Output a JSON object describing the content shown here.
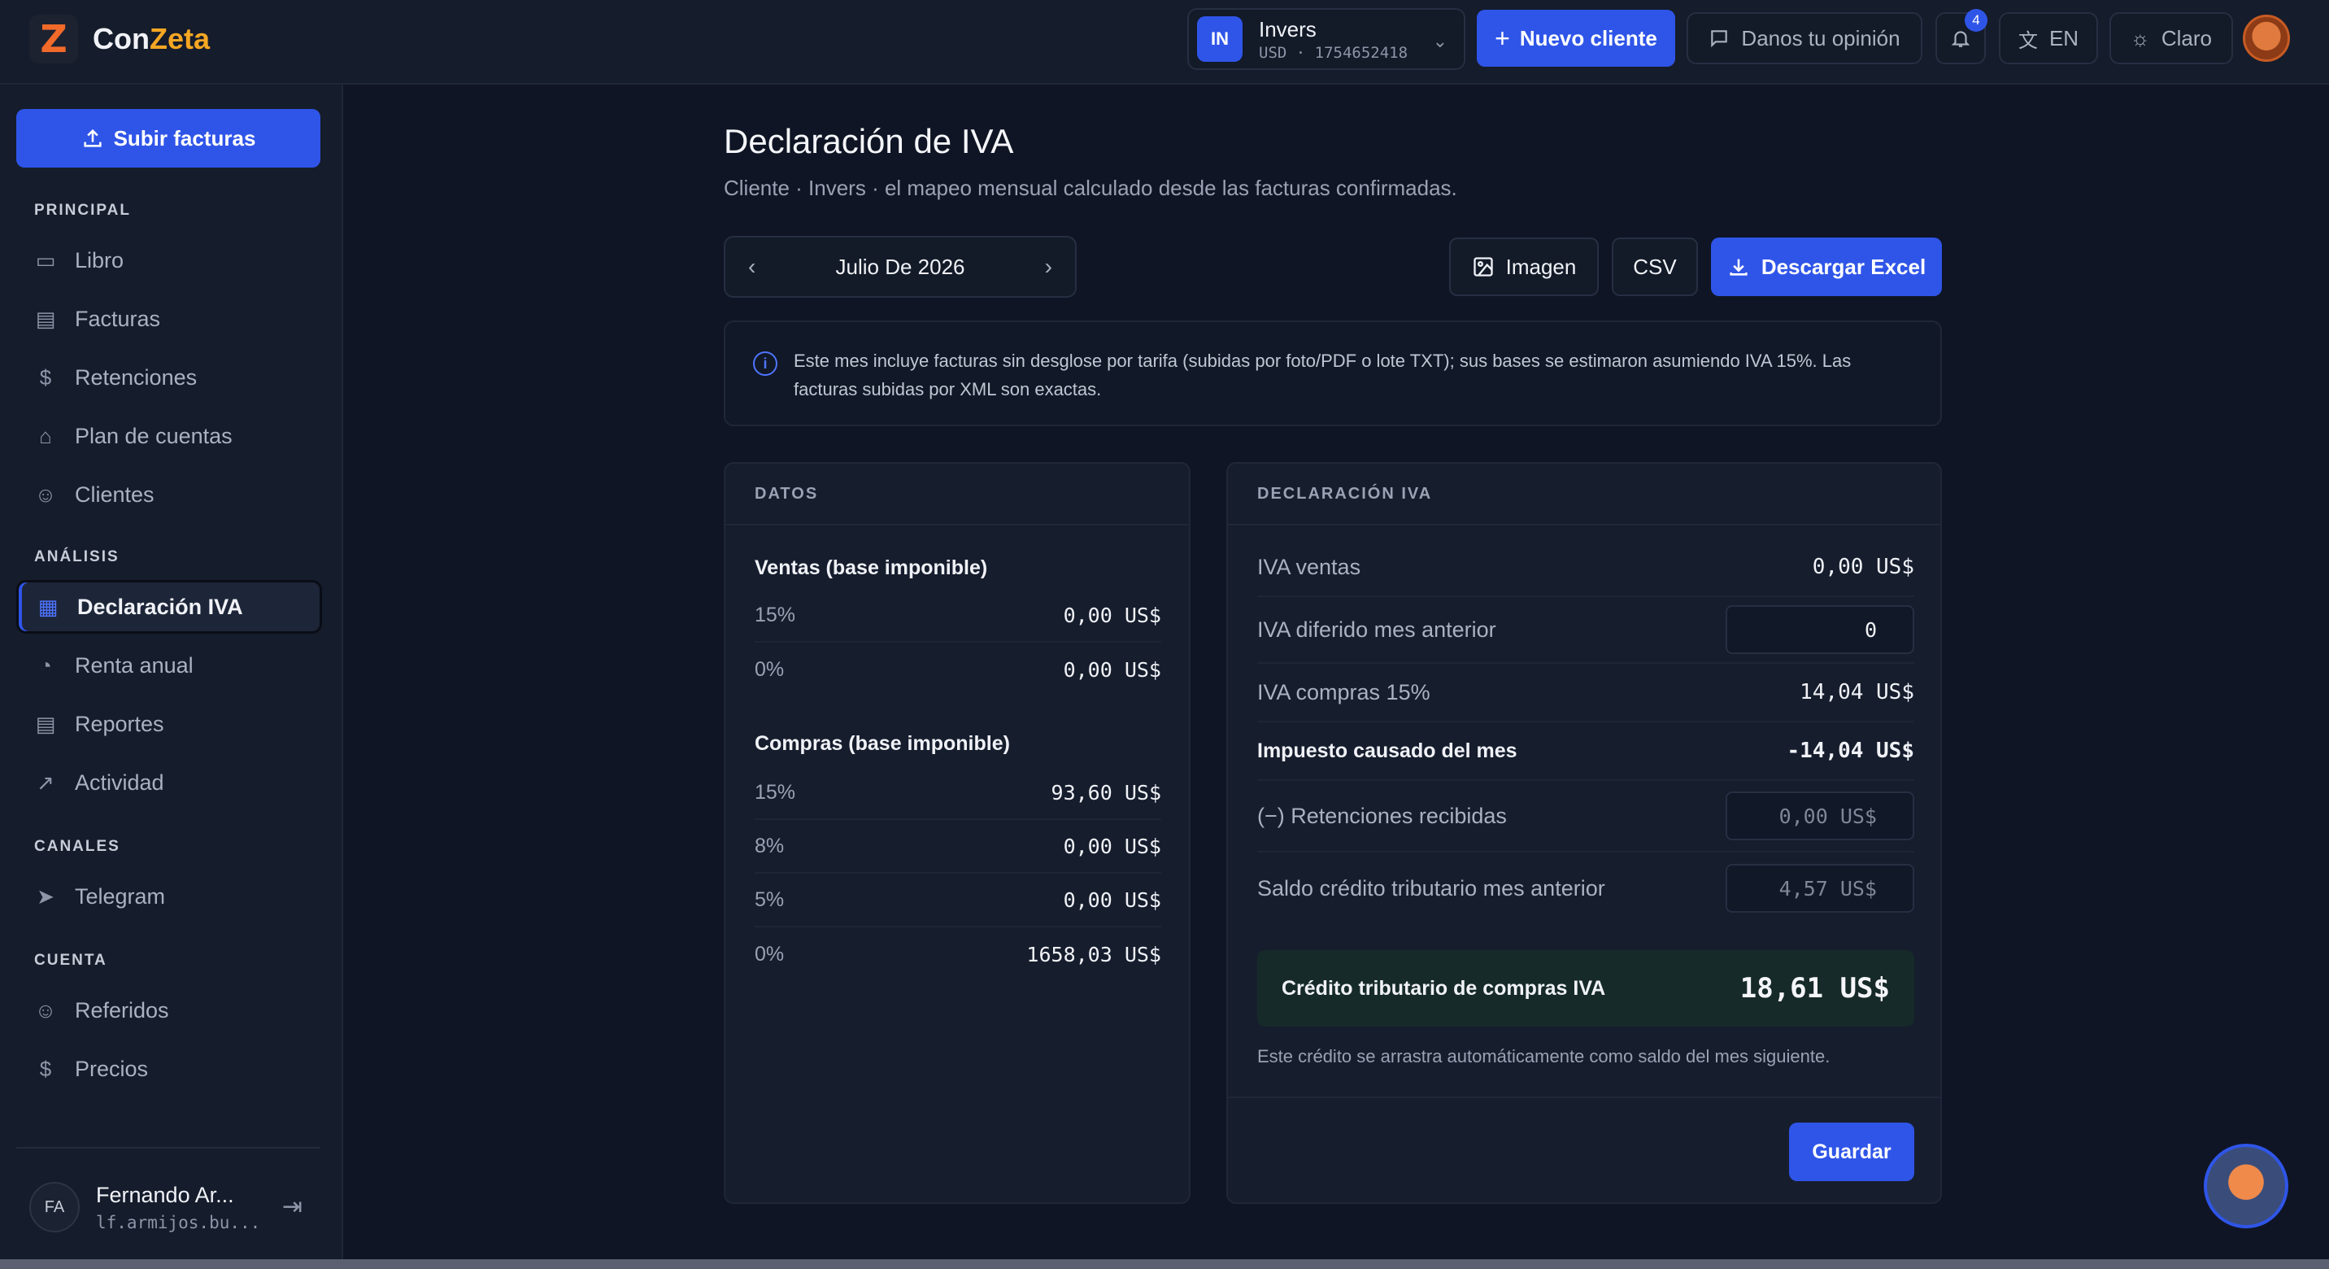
{
  "app": {
    "name_prefix": "Con",
    "name_accent": "Zeta",
    "logo_letter": "Z",
    "accent_color": "#2f55e8",
    "brand_color": "#f26a2a"
  },
  "topbar": {
    "client": {
      "badge": "IN",
      "name": "Invers",
      "sub": "USD · 1754652418"
    },
    "new_client": "Nuevo cliente",
    "feedback": "Danos tu opinión",
    "notifications_count": "4",
    "language": "EN",
    "theme": "Claro"
  },
  "sidebar": {
    "upload": "Subir facturas",
    "sections": {
      "principal": "PRINCIPAL",
      "analisis": "ANÁLISIS",
      "canales": "CANALES",
      "cuenta": "CUENTA"
    },
    "items": {
      "libro": "Libro",
      "facturas": "Facturas",
      "retenciones": "Retenciones",
      "plan": "Plan de cuentas",
      "clientes": "Clientes",
      "declaracion": "Declaración IVA",
      "renta": "Renta anual",
      "reportes": "Reportes",
      "actividad": "Actividad",
      "telegram": "Telegram",
      "referidos": "Referidos",
      "precios": "Precios"
    },
    "user": {
      "initials": "FA",
      "name": "Fernando Ar...",
      "email": "lf.armijos.bu..."
    }
  },
  "main": {
    "title": "Declaración de IVA",
    "subtitle": "Cliente · Invers · el mapeo mensual calculado desde las facturas confirmadas.",
    "month": "Julio De 2026",
    "actions": {
      "image": "Imagen",
      "csv": "CSV",
      "excel": "Descargar Excel"
    },
    "info": "Este mes incluye facturas sin desglose por tarifa (subidas por foto/PDF o lote TXT); sus bases se estimaron asumiendo IVA 15%. Las facturas subidas por XML son exactas."
  },
  "datos": {
    "header": "DATOS",
    "ventas_title": "Ventas (base imponible)",
    "ventas": [
      {
        "rate": "15%",
        "value": "0,00 US$"
      },
      {
        "rate": "0%",
        "value": "0,00 US$"
      }
    ],
    "compras_title": "Compras (base imponible)",
    "compras": [
      {
        "rate": "15%",
        "value": "93,60 US$"
      },
      {
        "rate": "8%",
        "value": "0,00 US$"
      },
      {
        "rate": "5%",
        "value": "0,00 US$"
      },
      {
        "rate": "0%",
        "value": "1658,03 US$"
      }
    ]
  },
  "declaracion": {
    "header": "DECLARACIÓN IVA",
    "iva_ventas_label": "IVA ventas",
    "iva_ventas_value": "0,00 US$",
    "diferido_label": "IVA diferido mes anterior",
    "diferido_value": "0",
    "iva_compras_label": "IVA compras 15%",
    "iva_compras_value": "14,04 US$",
    "impuesto_label": "Impuesto causado del mes",
    "impuesto_value": "-14,04 US$",
    "retenciones_label": "(−) Retenciones recibidas",
    "retenciones_value": "0,00 US$",
    "saldo_label": "Saldo crédito tributario mes anterior",
    "saldo_value": "4,57 US$",
    "credito_label": "Crédito tributario de compras IVA",
    "credito_value": "18,61 US$",
    "credito_note": "Este crédito se arrastra automáticamente como saldo del mes siguiente.",
    "save": "Guardar"
  }
}
